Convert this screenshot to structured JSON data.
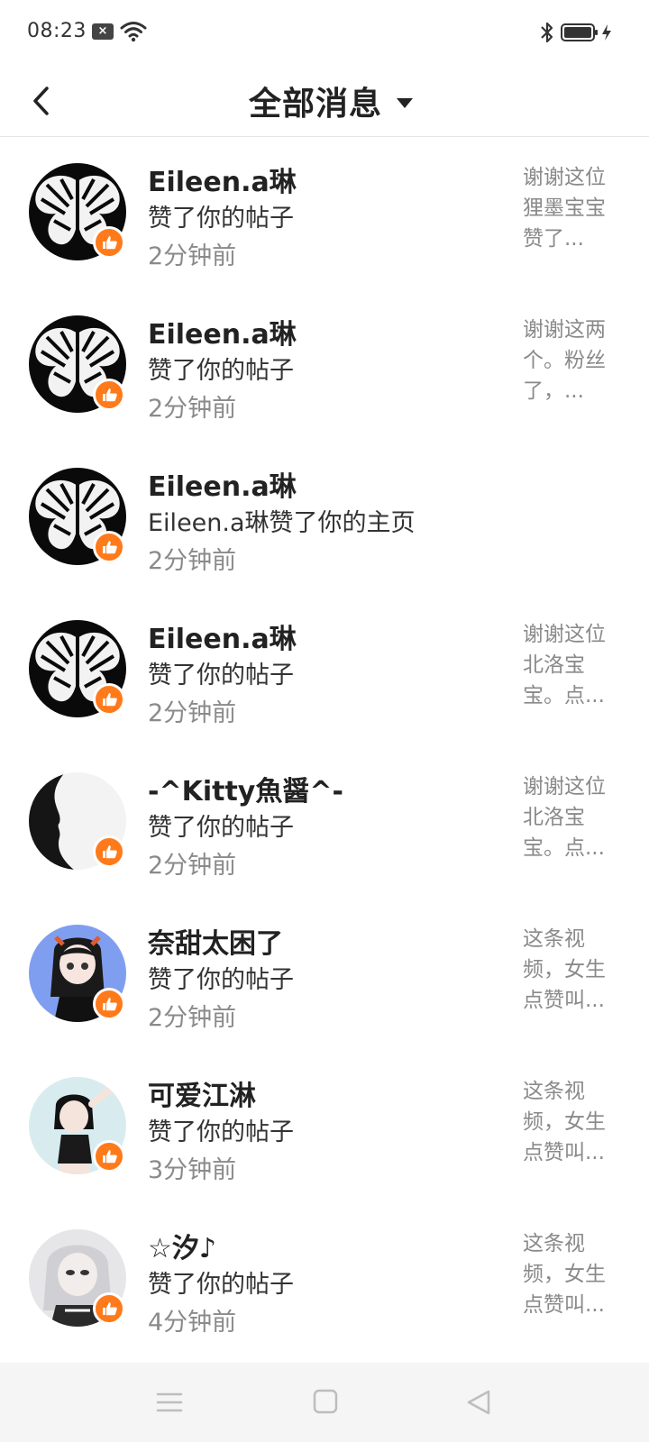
{
  "status_bar": {
    "time": "08:23",
    "notification_icon": "close-box-icon",
    "icons": [
      "wifi-icon",
      "bluetooth-icon",
      "battery-icon",
      "charging-icon"
    ]
  },
  "header": {
    "back_icon": "chevron-left-icon",
    "title": "全部消息",
    "dropdown_icon": "caret-down-icon"
  },
  "colors": {
    "like_badge": "#ff7a1a",
    "text_primary": "#222222",
    "text_secondary": "#8a8a8a",
    "nav_bar": "#f5f5f5"
  },
  "messages": [
    {
      "name": "Eileen.a琳",
      "action": "赞了你的帖子",
      "time": "2分钟前",
      "preview": "谢谢这位狸墨宝宝赞了..."
    },
    {
      "name": "Eileen.a琳",
      "action": "赞了你的帖子",
      "time": "2分钟前",
      "preview": "谢谢这两个。粉丝了，..."
    },
    {
      "name": "Eileen.a琳",
      "action": "Eileen.a琳赞了你的主页",
      "time": "2分钟前",
      "preview": ""
    },
    {
      "name": "Eileen.a琳",
      "action": "赞了你的帖子",
      "time": "2分钟前",
      "preview": "谢谢这位北洛宝宝。点..."
    },
    {
      "name": "-^Kitty魚醤^-",
      "action": "赞了你的帖子",
      "time": "2分钟前",
      "preview": "谢谢这位北洛宝宝。点..."
    },
    {
      "name": "奈甜太困了",
      "action": "赞了你的帖子",
      "time": "2分钟前",
      "preview": "这条视频，女生点赞叫..."
    },
    {
      "name": "可爱江淋",
      "action": "赞了你的帖子",
      "time": "3分钟前",
      "preview": "这条视频，女生点赞叫..."
    },
    {
      "name": "☆汐♪",
      "action": "赞了你的帖子",
      "time": "4分钟前",
      "preview": "这条视频，女生点赞叫..."
    }
  ],
  "nav_bar": {
    "icons": [
      "menu-icon",
      "home-square-icon",
      "back-triangle-icon"
    ]
  }
}
